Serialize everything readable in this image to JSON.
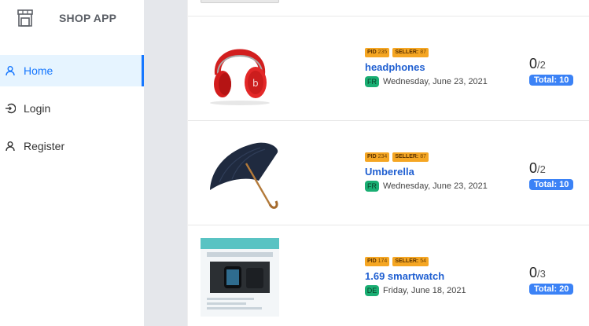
{
  "app": {
    "title": "SHOP APP"
  },
  "sidebar": {
    "items": [
      {
        "label": "Home",
        "icon": "user-icon",
        "active": true
      },
      {
        "label": "Login",
        "icon": "login-icon",
        "active": false
      },
      {
        "label": "Register",
        "icon": "user-icon",
        "active": false
      }
    ]
  },
  "products": [
    {
      "pid_label": "PID",
      "pid": "235",
      "seller_label": "SELLER:",
      "seller": "87",
      "name": "headphones",
      "country": "FR",
      "date": "Wednesday, June 23, 2021",
      "count": "0",
      "of": "/2",
      "total": "Total: 10"
    },
    {
      "pid_label": "PID",
      "pid": "234",
      "seller_label": "SELLER:",
      "seller": "87",
      "name": "Umberella",
      "country": "FR",
      "date": "Wednesday, June 23, 2021",
      "count": "0",
      "of": "/2",
      "total": "Total: 10"
    },
    {
      "pid_label": "PID",
      "pid": "174",
      "seller_label": "SELLER:",
      "seller": "54",
      "name": "1.69 smartwatch",
      "country": "DE",
      "date": "Friday, June 18, 2021",
      "count": "0",
      "of": "/3",
      "total": "Total: 20"
    }
  ],
  "colors": {
    "accent": "#1677ff",
    "badge": "#f5a623",
    "title": "#1f5fd1",
    "country": "#1aae73",
    "total": "#3b82f6"
  }
}
